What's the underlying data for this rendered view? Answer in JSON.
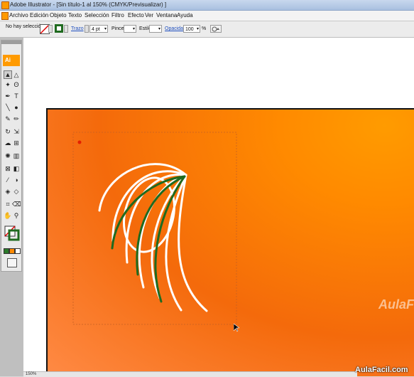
{
  "window": {
    "title": "Adobe Illustrator - [Sin título-1 al 150% (CMYK/Previsualizar) ]"
  },
  "menu": {
    "items": [
      "Archivo",
      "Edición",
      "Objeto",
      "Texto",
      "Selección",
      "Filtro",
      "Efecto",
      "Ver",
      "Ventana",
      "Ayuda"
    ]
  },
  "control_bar": {
    "selection_status": "No hay selección",
    "stroke_label": "Trazo",
    "stroke_weight": "4 pt",
    "brush_label": "Pincel:",
    "style_label": "Estilo:",
    "opacity_label": "Opacidad:",
    "opacity_value": "100",
    "opacity_unit": "%"
  },
  "toolbox": {
    "badge": "Ai",
    "tools": [
      "selection-tool",
      "direct-selection-tool",
      "magic-wand-tool",
      "lasso-tool",
      "pen-tool",
      "type-tool",
      "line-tool",
      "ellipse-tool",
      "paintbrush-tool",
      "pencil-tool",
      "rotate-tool",
      "scale-tool",
      "warp-tool",
      "free-transform-tool",
      "symbol-sprayer-tool",
      "column-graph-tool",
      "mesh-tool",
      "gradient-tool",
      "eyedropper-tool",
      "blend-tool",
      "live-paint-tool",
      "live-paint-selection-tool",
      "crop-tool",
      "eraser-tool",
      "hand-tool",
      "zoom-tool"
    ],
    "stroke_color": "#1f6a1f",
    "fill": "none"
  },
  "artboard": {
    "gradient_start": "#ff9b00",
    "gradient_end": "#f46a0b",
    "artwork_stroke_white": "#ffffff",
    "artwork_stroke_green": "#1f6a1f",
    "watermark": "AulaF"
  },
  "status": {
    "zoom": "150%"
  },
  "brand": "AulaFacil.com"
}
